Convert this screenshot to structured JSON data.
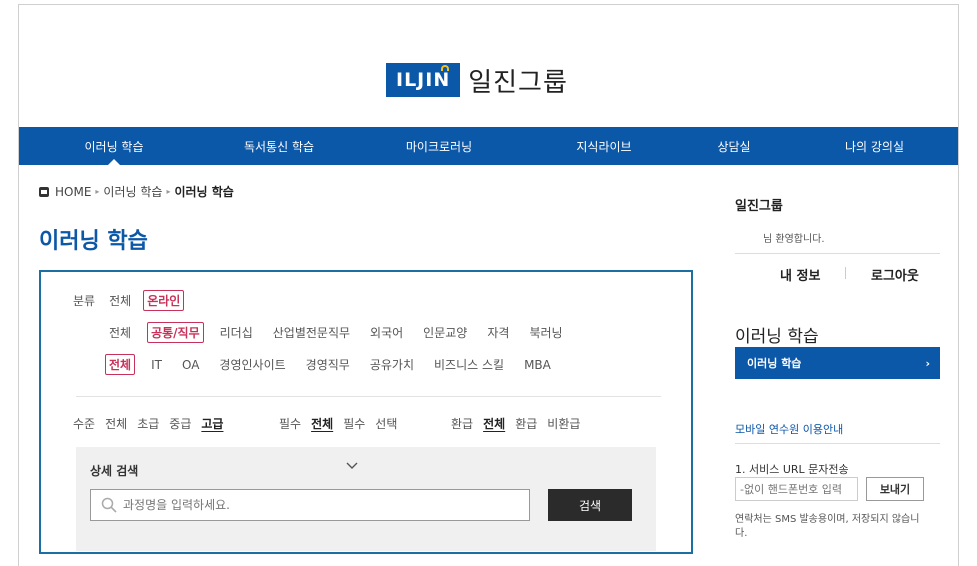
{
  "logo": {
    "brand": "ILJIN",
    "name": "일진그룹"
  },
  "nav": [
    {
      "label": "이러닝 학습",
      "active": true
    },
    {
      "label": "독서통신 학습",
      "active": false
    },
    {
      "label": "마이크로러닝",
      "active": false
    },
    {
      "label": "지식라이브",
      "active": false
    },
    {
      "label": "상담실",
      "active": false
    },
    {
      "label": "나의 강의실",
      "active": false
    }
  ],
  "breadcrumb": {
    "home": "HOME",
    "level1": "이러닝 학습",
    "level2": "이러닝 학습"
  },
  "page_title": "이러닝 학습",
  "filters": {
    "category_label": "분류",
    "category": [
      "전체",
      "온라인"
    ],
    "category_selected": "온라인",
    "subjects": [
      "전체",
      "공통/직무",
      "리더십",
      "산업별전문직무",
      "외국어",
      "인문교양",
      "자격",
      "북러닝"
    ],
    "subject_selected": "공통/직무",
    "subcats": [
      "전체",
      "IT",
      "OA",
      "경영인사이트",
      "경영직무",
      "공유가치",
      "비즈니스 스킬",
      "MBA"
    ],
    "subcat_selected": "전체",
    "level_label": "수준",
    "levels": [
      "전체",
      "초급",
      "중급",
      "고급"
    ],
    "level_selected": "고급",
    "required_label": "필수",
    "required": [
      "전체",
      "필수",
      "선택"
    ],
    "required_selected": "전체",
    "refund_label": "환급",
    "refund": [
      "전체",
      "환급",
      "비환급"
    ],
    "refund_selected": "전체"
  },
  "search": {
    "title": "상세 검색",
    "placeholder": "과정명을 입력하세요.",
    "button": "검색"
  },
  "sidebar": {
    "group": "일진그룹",
    "welcome": "님 환영합니다.",
    "my_info": "내 정보",
    "logout": "로그아웃",
    "section_title": "이러닝 학습",
    "menu_item": "이러닝 학습",
    "mobile_guide": "모바일 연수원 이용안내",
    "sms_title": "1. 서비스 URL 문자전송",
    "phone_placeholder": "-없이 핸드폰번호 입력",
    "send_button": "보내기",
    "note": "연락처는 SMS 발송용이며, 저장되지 않습니다."
  },
  "colors": {
    "brand": "#0b57a8",
    "accent": "#c8325a",
    "dark_button": "#2b2b2b"
  }
}
